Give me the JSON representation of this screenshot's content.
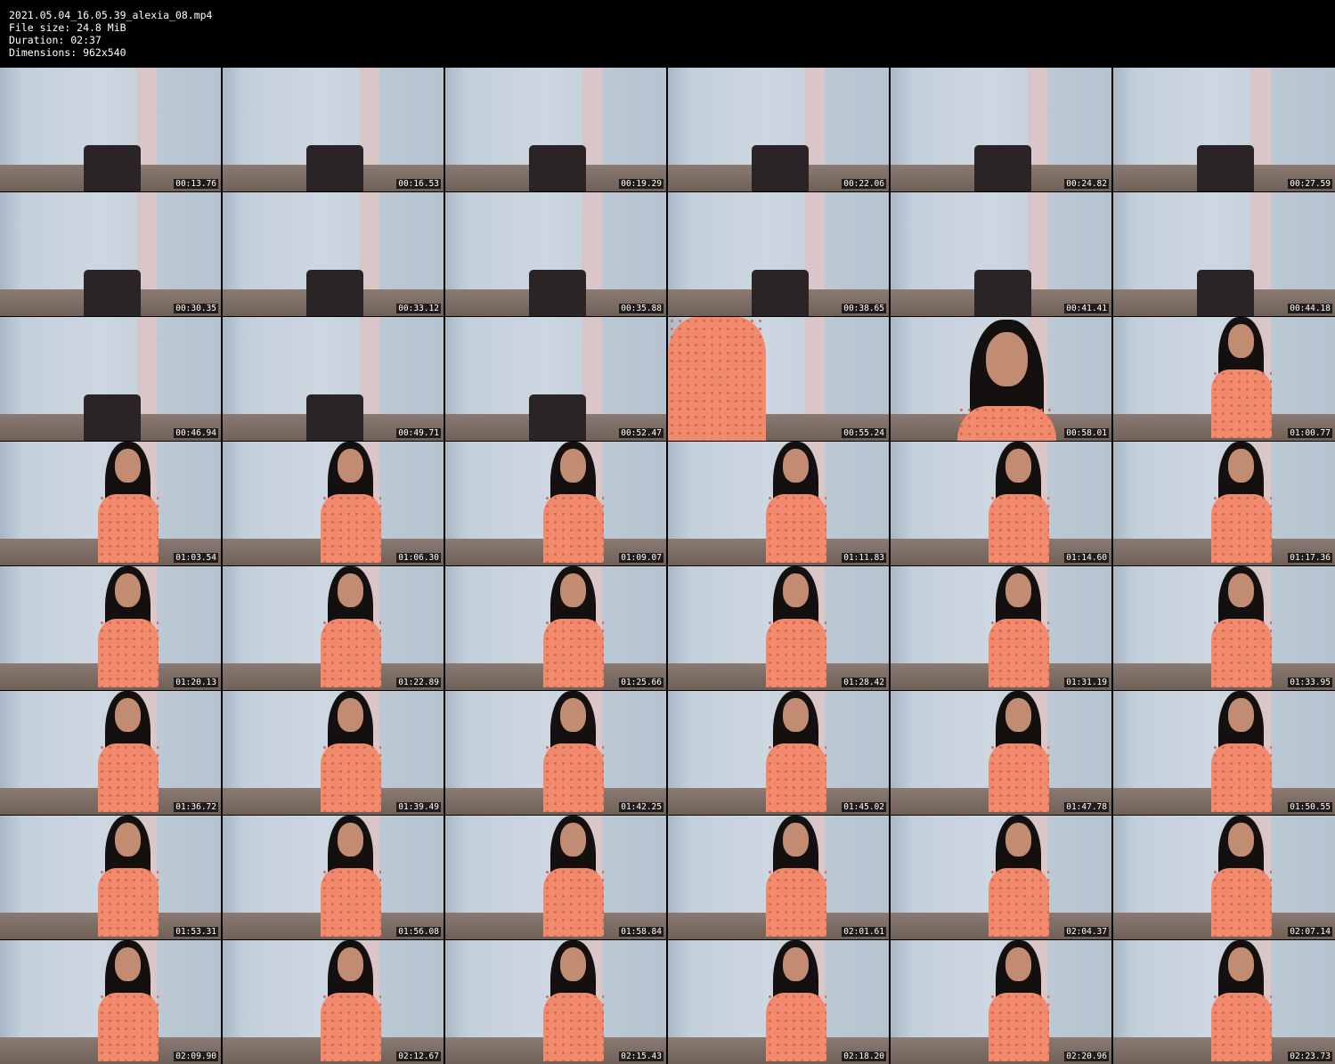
{
  "header": {
    "filename": "2021.05.04_16.05.39_alexia_08.mp4",
    "file_size": "File size: 24.8 MiB",
    "duration": "Duration: 02:37",
    "dimensions": "Dimensions: 962x540"
  },
  "thumbnails": [
    {
      "time": "00:13.76",
      "scene": "empty"
    },
    {
      "time": "00:16.53",
      "scene": "empty"
    },
    {
      "time": "00:19.29",
      "scene": "empty"
    },
    {
      "time": "00:22.06",
      "scene": "empty"
    },
    {
      "time": "00:24.82",
      "scene": "empty"
    },
    {
      "time": "00:27.59",
      "scene": "empty"
    },
    {
      "time": "00:30.35",
      "scene": "empty"
    },
    {
      "time": "00:33.12",
      "scene": "empty"
    },
    {
      "time": "00:35.88",
      "scene": "empty"
    },
    {
      "time": "00:38.65",
      "scene": "empty"
    },
    {
      "time": "00:41.41",
      "scene": "empty"
    },
    {
      "time": "00:44.18",
      "scene": "empty"
    },
    {
      "time": "00:46.94",
      "scene": "empty"
    },
    {
      "time": "00:49.71",
      "scene": "empty"
    },
    {
      "time": "00:52.47",
      "scene": "far"
    },
    {
      "time": "00:55.24",
      "scene": "closeup-body"
    },
    {
      "time": "00:58.01",
      "scene": "closeup-face"
    },
    {
      "time": "01:00.77",
      "scene": "seated"
    },
    {
      "time": "01:03.54",
      "scene": "seated-left"
    },
    {
      "time": "01:06.30",
      "scene": "seated"
    },
    {
      "time": "01:09.07",
      "scene": "seated"
    },
    {
      "time": "01:11.83",
      "scene": "seated"
    },
    {
      "time": "01:14.60",
      "scene": "seated"
    },
    {
      "time": "01:17.36",
      "scene": "seated"
    },
    {
      "time": "01:20.13",
      "scene": "seated-left"
    },
    {
      "time": "01:22.89",
      "scene": "seated"
    },
    {
      "time": "01:25.66",
      "scene": "seated"
    },
    {
      "time": "01:28.42",
      "scene": "seated"
    },
    {
      "time": "01:31.19",
      "scene": "seated"
    },
    {
      "time": "01:33.95",
      "scene": "seated"
    },
    {
      "time": "01:36.72",
      "scene": "seated-left"
    },
    {
      "time": "01:39.49",
      "scene": "seated"
    },
    {
      "time": "01:42.25",
      "scene": "seated"
    },
    {
      "time": "01:45.02",
      "scene": "seated"
    },
    {
      "time": "01:47.78",
      "scene": "seated"
    },
    {
      "time": "01:50.55",
      "scene": "seated"
    },
    {
      "time": "01:53.31",
      "scene": "seated-left"
    },
    {
      "time": "01:56.08",
      "scene": "seated"
    },
    {
      "time": "01:58.84",
      "scene": "seated"
    },
    {
      "time": "02:01.61",
      "scene": "seated"
    },
    {
      "time": "02:04.37",
      "scene": "seated"
    },
    {
      "time": "02:07.14",
      "scene": "seated"
    },
    {
      "time": "02:09.90",
      "scene": "seated-left"
    },
    {
      "time": "02:12.67",
      "scene": "seated"
    },
    {
      "time": "02:15.43",
      "scene": "seated"
    },
    {
      "time": "02:18.20",
      "scene": "seated"
    },
    {
      "time": "02:20.96",
      "scene": "seated"
    },
    {
      "time": "02:23.73",
      "scene": "seated"
    }
  ]
}
